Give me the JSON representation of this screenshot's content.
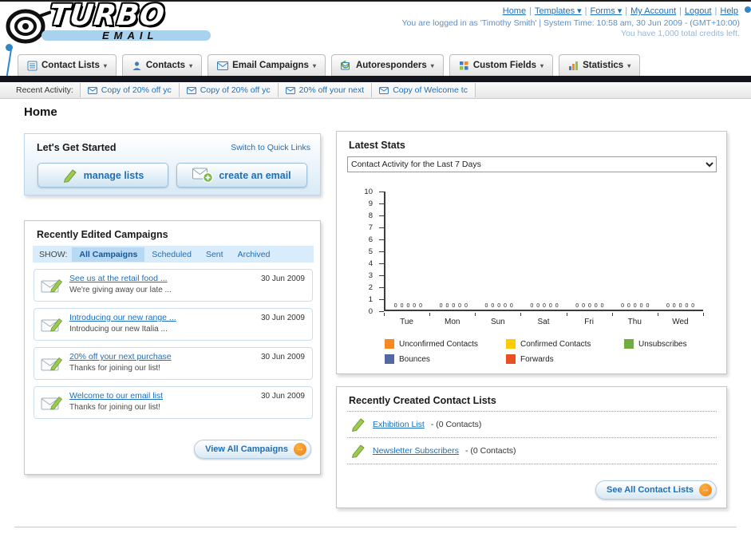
{
  "icons": {
    "arrow_right": "→",
    "caret_down": "▾"
  },
  "page_title": "Home",
  "header": {
    "logo_primary": "TURBO",
    "logo_secondary": "EMAIL",
    "links": [
      {
        "label": "Home",
        "caret": false
      },
      {
        "label": "Templates",
        "caret": true
      },
      {
        "label": "Forms",
        "caret": true
      },
      {
        "label": "My Account",
        "caret": false
      },
      {
        "label": "Logout",
        "caret": false
      },
      {
        "label": "Help",
        "caret": false
      }
    ],
    "session_line": "You are logged in as 'Timothy Smith' | System Time: 10:58 am, 30 Jun 2009 - (GMT+10:00)",
    "credits_line": "You have 1,000 total credits left."
  },
  "nav": {
    "tabs": [
      {
        "label": "Contact Lists",
        "icon": "contact-lists-icon"
      },
      {
        "label": "Contacts",
        "icon": "contacts-icon"
      },
      {
        "label": "Email Campaigns",
        "icon": "email-campaigns-icon"
      },
      {
        "label": "Autoresponders",
        "icon": "autoresponders-icon"
      },
      {
        "label": "Custom Fields",
        "icon": "custom-fields-icon"
      },
      {
        "label": "Statistics",
        "icon": "statistics-icon"
      }
    ]
  },
  "recent_activity": {
    "label": "Recent Activity:",
    "items": [
      "Copy of 20% off yc",
      "Copy of 20% off yc",
      "20% off your next",
      "Copy of Welcome tc"
    ]
  },
  "get_started": {
    "title": "Let's Get Started",
    "switch_link": "Switch to Quick Links",
    "buttons": [
      {
        "label": "manage lists"
      },
      {
        "label": "create an email"
      }
    ]
  },
  "campaigns": {
    "title": "Recently Edited Campaigns",
    "show_label": "SHOW:",
    "tabs": [
      "All Campaigns",
      "Scheduled",
      "Sent",
      "Archived"
    ],
    "selected_tab": 0,
    "items": [
      {
        "title": "See us at the retail food ...",
        "subtitle": "We're giving away our late ...",
        "date": "30 Jun 2009"
      },
      {
        "title": "Introducing our new range ...",
        "subtitle": "Introducing our new Italia ...",
        "date": "30 Jun 2009"
      },
      {
        "title": "20% off your next purchase",
        "subtitle": "Thanks for joining our list!",
        "date": "30 Jun 2009"
      },
      {
        "title": "Welcome to our email list",
        "subtitle": "Thanks for joining our list!",
        "date": "30 Jun 2009"
      }
    ],
    "view_all_label": "View All Campaigns"
  },
  "stats": {
    "title": "Latest Stats",
    "dropdown_value": "Contact Activity for the Last 7 Days",
    "chart_data": {
      "type": "bar",
      "title": "Contact Activity for the Last 7 Days",
      "categories": [
        "Tue",
        "Mon",
        "Sun",
        "Sat",
        "Fri",
        "Thu",
        "Wed"
      ],
      "series": [
        {
          "name": "Unconfirmed Contacts",
          "color": "#f6891f",
          "values": [
            0,
            0,
            0,
            0,
            0,
            0,
            0
          ]
        },
        {
          "name": "Confirmed Contacts",
          "color": "#ffcb05",
          "values": [
            0,
            0,
            0,
            0,
            0,
            0,
            0
          ]
        },
        {
          "name": "Unsubscribes",
          "color": "#6fae3c",
          "values": [
            0,
            0,
            0,
            0,
            0,
            0,
            0
          ]
        },
        {
          "name": "Bounces",
          "color": "#51699f",
          "values": [
            0,
            0,
            0,
            0,
            0,
            0,
            0
          ]
        },
        {
          "name": "Forwards",
          "color": "#e8501f",
          "values": [
            0,
            0,
            0,
            0,
            0,
            0,
            0
          ]
        }
      ],
      "ylim": [
        0,
        10
      ],
      "ytick_step": 1,
      "value_labels_shown": true,
      "legend_position": "bottom",
      "grid": false
    }
  },
  "contact_lists": {
    "title": "Recently Created Contact Lists",
    "items": [
      {
        "name": "Exhibition List",
        "suffix": "- (0 Contacts)"
      },
      {
        "name": "Newsletter Subscribers",
        "suffix": "- (0 Contacts)"
      }
    ],
    "see_all_label": "See All Contact Lists"
  }
}
